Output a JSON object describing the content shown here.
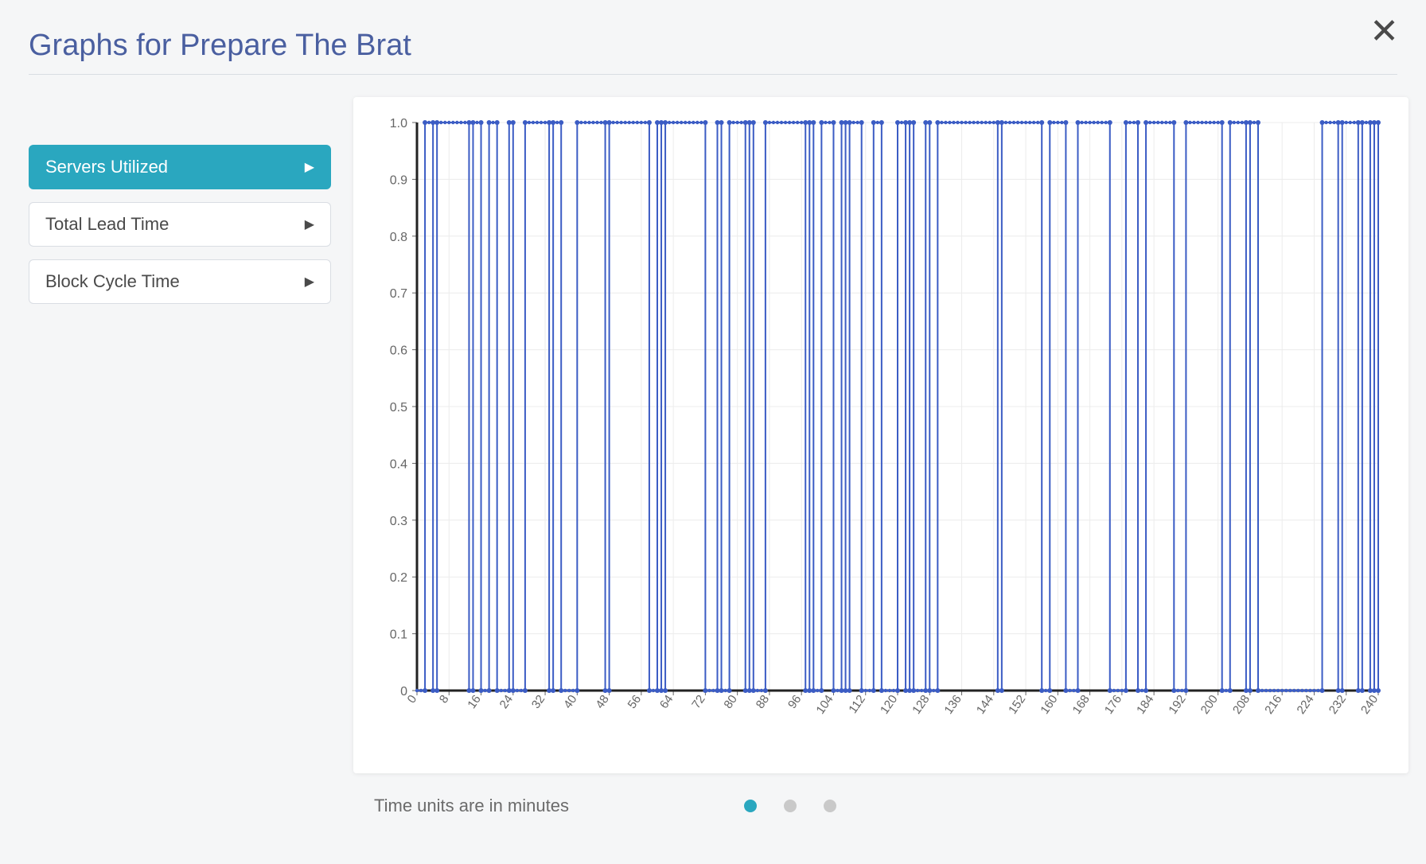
{
  "header": {
    "title": "Graphs for Prepare The Brat"
  },
  "sidebar": {
    "items": [
      {
        "label": "Servers Utilized",
        "active": true
      },
      {
        "label": "Total Lead Time",
        "active": false
      },
      {
        "label": "Block Cycle Time",
        "active": false
      }
    ]
  },
  "footer": {
    "units_text": "Time units are in minutes",
    "page_dots": 3,
    "active_dot": 0
  },
  "chart_data": {
    "type": "line",
    "title": "",
    "xlabel": "",
    "ylabel": "",
    "xlim": [
      0,
      240
    ],
    "ylim": [
      0,
      1.0
    ],
    "x_ticks": [
      0,
      8,
      16,
      24,
      32,
      40,
      48,
      56,
      64,
      72,
      80,
      88,
      96,
      104,
      112,
      120,
      128,
      136,
      144,
      152,
      160,
      168,
      176,
      184,
      192,
      200,
      208,
      216,
      224,
      232,
      240
    ],
    "y_ticks": [
      0,
      0.1,
      0.2,
      0.3,
      0.4,
      0.5,
      0.6,
      0.7,
      0.8,
      0.9,
      1.0
    ],
    "grid": true,
    "note": "Binary signal toggling between 0 and 1 over time. 'high_segments' are [start,end] x-ranges where value is 1; elsewhere value is 0.",
    "high_segments": [
      [
        2,
        4
      ],
      [
        5,
        13
      ],
      [
        14,
        16
      ],
      [
        18,
        20
      ],
      [
        23,
        24
      ],
      [
        27,
        33
      ],
      [
        34,
        36
      ],
      [
        40,
        47
      ],
      [
        48,
        58
      ],
      [
        60,
        61
      ],
      [
        62,
        72
      ],
      [
        75,
        76
      ],
      [
        78,
        82
      ],
      [
        83,
        84
      ],
      [
        87,
        97
      ],
      [
        98,
        99
      ],
      [
        101,
        104
      ],
      [
        106,
        107
      ],
      [
        108,
        111
      ],
      [
        114,
        116
      ],
      [
        120,
        122
      ],
      [
        123,
        124
      ],
      [
        127,
        128
      ],
      [
        130,
        145
      ],
      [
        146,
        156
      ],
      [
        158,
        162
      ],
      [
        165,
        173
      ],
      [
        177,
        180
      ],
      [
        182,
        189
      ],
      [
        192,
        201
      ],
      [
        203,
        207
      ],
      [
        208,
        210
      ],
      [
        226,
        230
      ],
      [
        231,
        235
      ],
      [
        236,
        238
      ],
      [
        239,
        240
      ]
    ]
  }
}
